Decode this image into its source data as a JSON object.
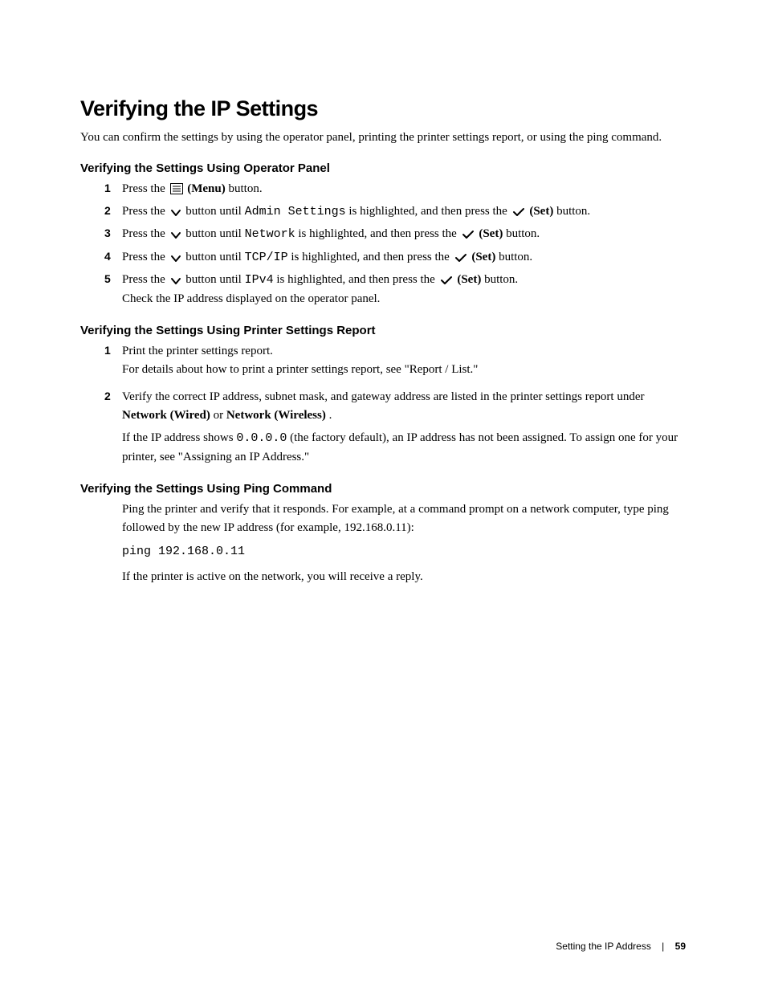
{
  "title": "Verifying the IP Settings",
  "intro": "You can confirm the settings by using the operator panel, printing the printer settings report, or using the ping command.",
  "sectionA": {
    "heading": "Verifying the Settings Using Operator Panel",
    "step1_a": "Press the ",
    "step1_b": "(Menu)",
    "step1_c": " button.",
    "step2_a": "Press the ",
    "step2_b": " button until ",
    "step2_mono": "Admin Settings",
    "step2_c": " is highlighted, and then press the ",
    "step2_d": "(Set)",
    "step2_e": " button.",
    "step3_a": "Press the ",
    "step3_b": " button until ",
    "step3_mono": "Network",
    "step3_c": " is highlighted, and then press the ",
    "step3_d": "(Set)",
    "step3_e": " button.",
    "step4_a": "Press the ",
    "step4_b": " button until ",
    "step4_mono": "TCP/IP",
    "step4_c": " is highlighted, and then press the ",
    "step4_d": "(Set)",
    "step4_e": " button.",
    "step5_a": "Press the ",
    "step5_b": " button until ",
    "step5_mono": "IPv4",
    "step5_c": " is highlighted, and then press the ",
    "step5_d": "(Set)",
    "step5_e": " button.",
    "step5_line2": "Check the IP address displayed on the operator panel."
  },
  "sectionB": {
    "heading": "Verifying the Settings Using Printer Settings Report",
    "step1_a": "Print the printer settings report.",
    "step1_b": "For details about how to print a printer settings report, see \"Report / List.\"",
    "step2_a": "Verify the correct IP address, subnet mask, and gateway address are listed in the printer settings report under ",
    "step2_b1": "Network (Wired)",
    "step2_mid": " or ",
    "step2_b2": "Network (Wireless)",
    "step2_end": ".",
    "step2_c1": "If the IP address shows ",
    "step2_mono": "0.0.0.0",
    "step2_c2": " (the factory default), an IP address has not been assigned. To assign one for your printer, see \"Assigning an IP Address.\""
  },
  "sectionC": {
    "heading": "Verifying the Settings Using Ping Command",
    "p1": "Ping the printer and verify that it responds. For example, at a command prompt on a network computer, type ping followed by the new IP address (for example, 192.168.0.11):",
    "cmd": "ping 192.168.0.11",
    "p2": "If the printer is active on the network, you will receive a reply."
  },
  "footer": {
    "section": "Setting the IP Address",
    "pagenum": "59"
  },
  "nums": {
    "n1": "1",
    "n2": "2",
    "n3": "3",
    "n4": "4",
    "n5": "5"
  }
}
